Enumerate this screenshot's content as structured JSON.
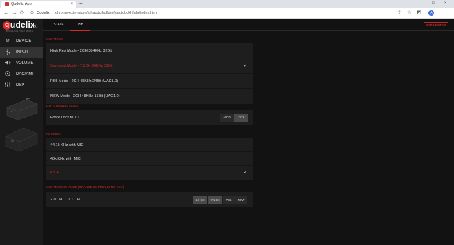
{
  "browser": {
    "tab_title": "Qudelix App",
    "tab_close": "×",
    "new_tab": "+",
    "window_min": "—",
    "window_max": "□",
    "window_close": "×",
    "back": "←",
    "forward": "→",
    "reload": "⟳",
    "lock": "🔒",
    "site_name": "Qudelix",
    "separator": "|",
    "url": "chrome-extension://phaodcihoffdmfkjaoigbgkhfahr/index.html",
    "profile_initial": "A"
  },
  "app": {
    "logo_letter": "q",
    "logo_word": "udelix",
    "logo_sub": "BRINGING YOU MORE",
    "collapse": "‹",
    "status": "CONNECTED",
    "accent": "#d42a2a",
    "sidebar": {
      "items": [
        {
          "label": "DEVICE",
          "icon": "gear-icon"
        },
        {
          "label": "INPUT",
          "icon": "usb-icon"
        },
        {
          "label": "VOLUME",
          "icon": "volume-icon"
        },
        {
          "label": "DAC/AMP",
          "icon": "dac-icon"
        },
        {
          "label": "DSP",
          "icon": "equalizer-icon"
        }
      ],
      "active": "INPUT"
    },
    "tabs": [
      {
        "label": "STATE",
        "active": false
      },
      {
        "label": "USB",
        "active": true
      }
    ],
    "usb_mode": {
      "title": "USB MODE",
      "options": [
        {
          "label": "High Res Mode - 2CH 384KHz 32Bit",
          "selected": false
        },
        {
          "label": "Surround Mode - 7.1CH 96KHz 32Bit",
          "selected": true
        },
        {
          "label": "PS5 Mode - 2CH 48KHz 24Bit (UAC1.0)",
          "selected": false
        },
        {
          "label": "NSW Mode - 2CH 48KHz 16Bit (UAC1.0)",
          "selected": false
        }
      ],
      "check": "✓"
    },
    "dsp_channel_mode": {
      "title": "DSP CHANNEL MODE",
      "label": "Force Lock to 7.1",
      "options": [
        "AUTO",
        "LOCK"
      ],
      "selected": "LOCK"
    },
    "fs_mode": {
      "title": "FS MODE",
      "options": [
        {
          "label": "44.1k KHz with MIC",
          "selected": false
        },
        {
          "label": "48k KHz with MIC",
          "selected": false
        },
        {
          "label": "FS ALL",
          "selected": true
        }
      ],
      "check": "✓"
    },
    "usb_mode_change": {
      "title": "USB MODE CHANGE (ORANGE BUTTON LONG KEY)",
      "label": "2.0 CH → 7.1 CH",
      "options": [
        "2.0 CH",
        "7.1 CH",
        "PS5",
        "NSW"
      ],
      "selected": [
        "2.0 CH",
        "7.1 CH"
      ]
    }
  }
}
